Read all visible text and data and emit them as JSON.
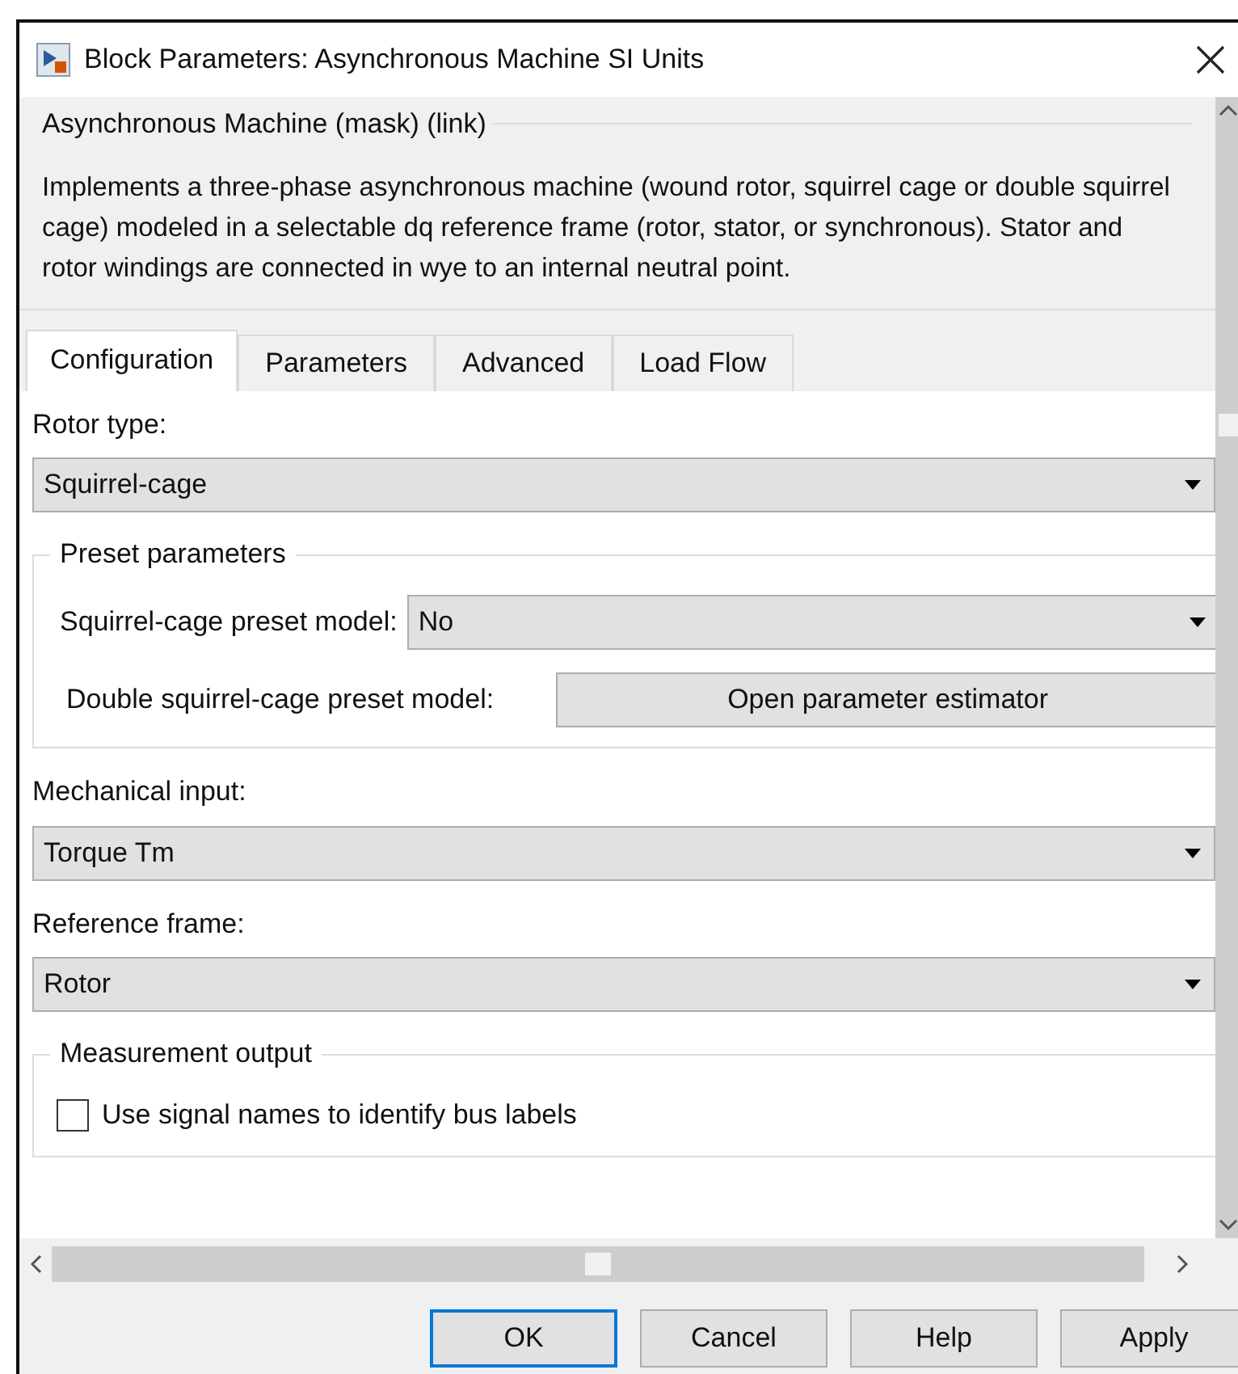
{
  "window": {
    "title": "Block Parameters: Asynchronous Machine SI Units"
  },
  "mask": {
    "title": "Asynchronous Machine (mask) (link)",
    "description": "Implements a three-phase asynchronous machine (wound rotor, squirrel cage or double squirrel cage) modeled in a selectable dq reference frame (rotor, stator, or synchronous). Stator and rotor windings are connected in wye to an internal neutral point."
  },
  "tabs": [
    {
      "label": "Configuration",
      "selected": true
    },
    {
      "label": "Parameters",
      "selected": false
    },
    {
      "label": "Advanced",
      "selected": false
    },
    {
      "label": "Load Flow",
      "selected": false
    }
  ],
  "fields": [
    {
      "kind": "dropdown",
      "label": "Rotor type:",
      "value": "Squirrel-cage"
    },
    {
      "kind": "group",
      "title": "Preset parameters",
      "rows": [
        {
          "kind": "dropdown",
          "label": "Squirrel-cage preset model:",
          "value": "No"
        },
        {
          "kind": "button",
          "label": "Double squirrel-cage preset model:",
          "button": "Open parameter estimator"
        }
      ]
    },
    {
      "kind": "dropdown",
      "label": "Mechanical input:",
      "value": "Torque Tm"
    },
    {
      "kind": "dropdown",
      "label": "Reference frame:",
      "value": "Rotor"
    },
    {
      "kind": "group",
      "title": "Measurement output",
      "rows": [
        {
          "kind": "checkbox",
          "label": "Use signal names to identify bus labels",
          "checked": false
        }
      ]
    }
  ],
  "buttons": [
    {
      "label": "OK",
      "default": true
    },
    {
      "label": "Cancel",
      "default": false
    },
    {
      "label": "Help",
      "default": false
    },
    {
      "label": "Apply",
      "default": false
    }
  ]
}
